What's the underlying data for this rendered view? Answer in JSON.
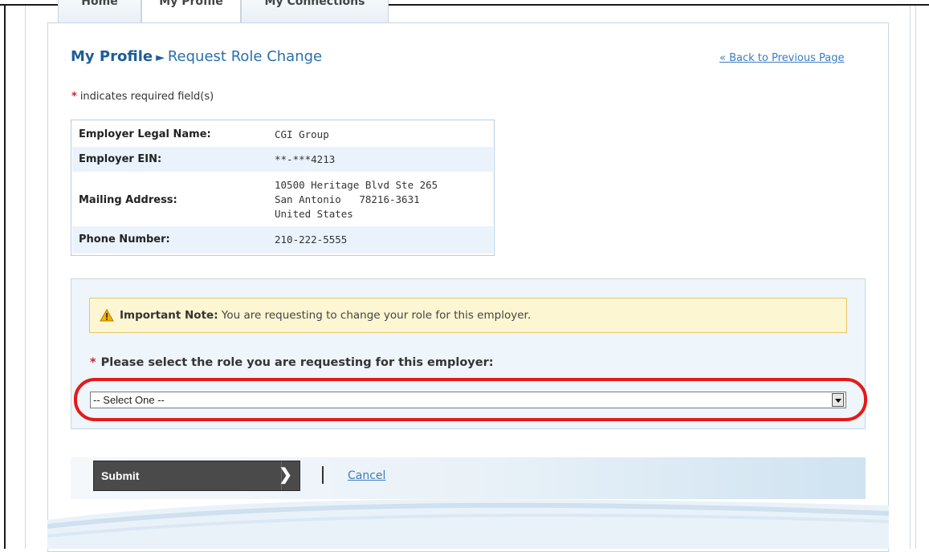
{
  "tabs": [
    {
      "label": "Home",
      "active": false
    },
    {
      "label": "My Profile",
      "active": true
    },
    {
      "label": "My Connections",
      "active": false
    }
  ],
  "breadcrumb": {
    "root": "My Profile",
    "separator": "►",
    "current": "Request Role Change"
  },
  "back_link": "« Back to Previous Page",
  "required_note": {
    "marker": "*",
    "text": "indicates required field(s)"
  },
  "employer_info": {
    "rows": [
      {
        "label": "Employer Legal Name:",
        "value_lines": [
          "CGI Group"
        ]
      },
      {
        "label": "Employer EIN:",
        "value_lines": [
          "**-***4213"
        ]
      },
      {
        "label": "Mailing Address:",
        "value_lines": [
          "10500 Heritage Blvd Ste 265",
          "San Antonio   78216-3631",
          "United States"
        ]
      },
      {
        "label": "Phone Number:",
        "value_lines": [
          "210-222-5555"
        ]
      }
    ]
  },
  "important_note": {
    "icon": "warning-icon",
    "title": "Important Note:",
    "text": "You are requesting to change your role for this employer."
  },
  "role_select": {
    "marker": "*",
    "label": "Please select the role you are requesting for this employer:",
    "selected": "-- Select One --"
  },
  "actions": {
    "submit": "Submit",
    "cancel": "Cancel"
  },
  "colors": {
    "link": "#3a7cc1",
    "required": "#d1202d",
    "highlight": "#e41a1a",
    "note_bg": "#fdf6d2",
    "submit_bg": "#4a4a4a"
  }
}
